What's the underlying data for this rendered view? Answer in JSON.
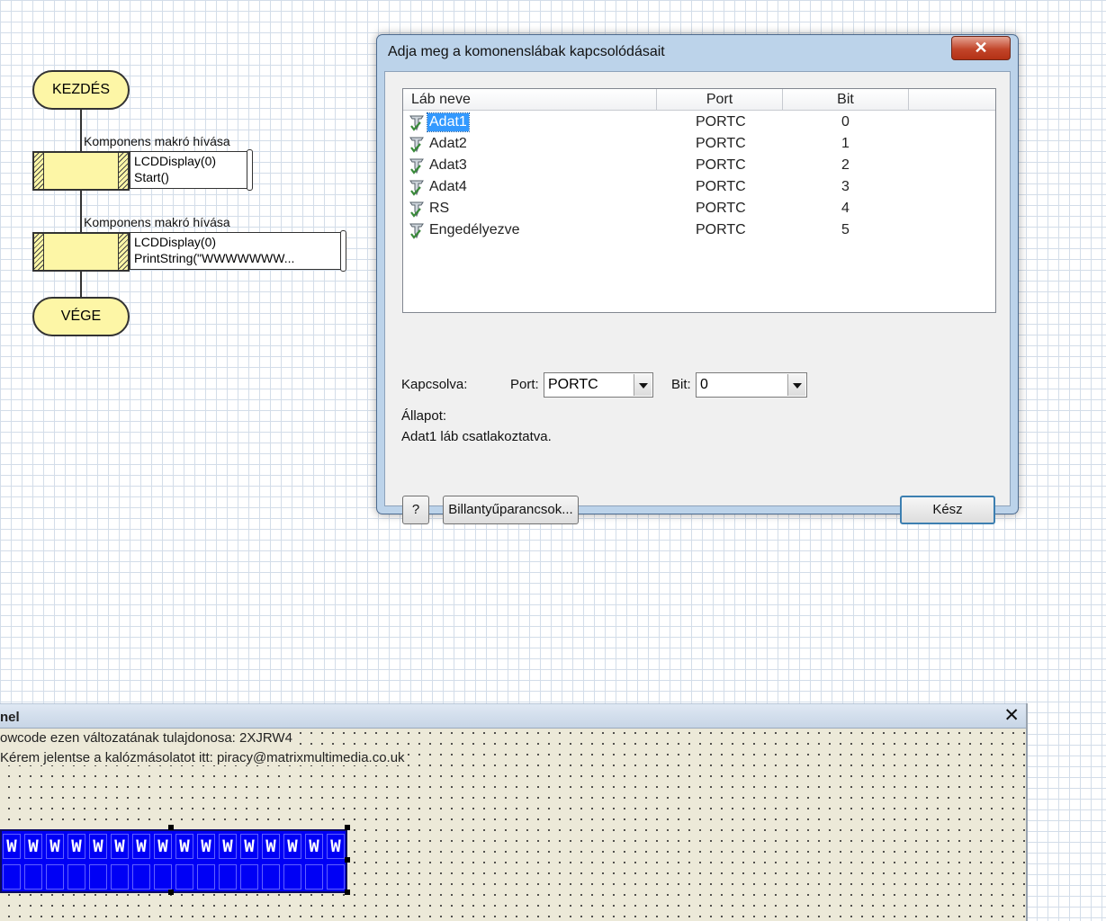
{
  "flowchart": {
    "start_label": "KEZDÉS",
    "end_label": "VÉGE",
    "macro_calls": [
      {
        "title": "Komponens makró hívása",
        "line1": "LCDDisplay(0)",
        "line2": "Start()"
      },
      {
        "title": "Komponens makró hívása",
        "line1": "LCDDisplay(0)",
        "line2": "PrintString(\"WWWWWWW..."
      }
    ]
  },
  "dialog": {
    "title": "Adja meg a komonenslábak kapcsolódásait",
    "close_label": "✕",
    "columns": [
      "Láb neve",
      "Port",
      "Bit"
    ],
    "rows": [
      {
        "name": "Adat1",
        "port": "PORTC",
        "bit": "0",
        "selected": true
      },
      {
        "name": "Adat2",
        "port": "PORTC",
        "bit": "1"
      },
      {
        "name": "Adat3",
        "port": "PORTC",
        "bit": "2"
      },
      {
        "name": "Adat4",
        "port": "PORTC",
        "bit": "3"
      },
      {
        "name": "RS",
        "port": "PORTC",
        "bit": "4"
      },
      {
        "name": "Engedélyezve",
        "port": "PORTC",
        "bit": "5"
      }
    ],
    "connected_label": "Kapcsolva:",
    "port_label": "Port:",
    "port_value": "PORTC",
    "bit_label": "Bit:",
    "bit_value": "0",
    "status_label": "Állapot:",
    "status_text": "Adat1 láb csatlakoztatva.",
    "help_button": "?",
    "shortcuts_button": "Billantyűparancsok...",
    "done_button": "Kész",
    "pin_icon_color": "#3a8a3a"
  },
  "panel": {
    "title": "nel",
    "close_label": "✕",
    "line1": "owcode ezen változatának tulajdonosa: 2XJRW4",
    "line2": "Kérem jelentse a kalózmásolatot itt: piracy@matrixmultimedia.co.uk",
    "lcd_row1": [
      "W",
      "W",
      "W",
      "W",
      "W",
      "W",
      "W",
      "W",
      "W",
      "W",
      "W",
      "W",
      "W",
      "W",
      "W",
      "W"
    ],
    "lcd_bg": "#0000f5"
  }
}
